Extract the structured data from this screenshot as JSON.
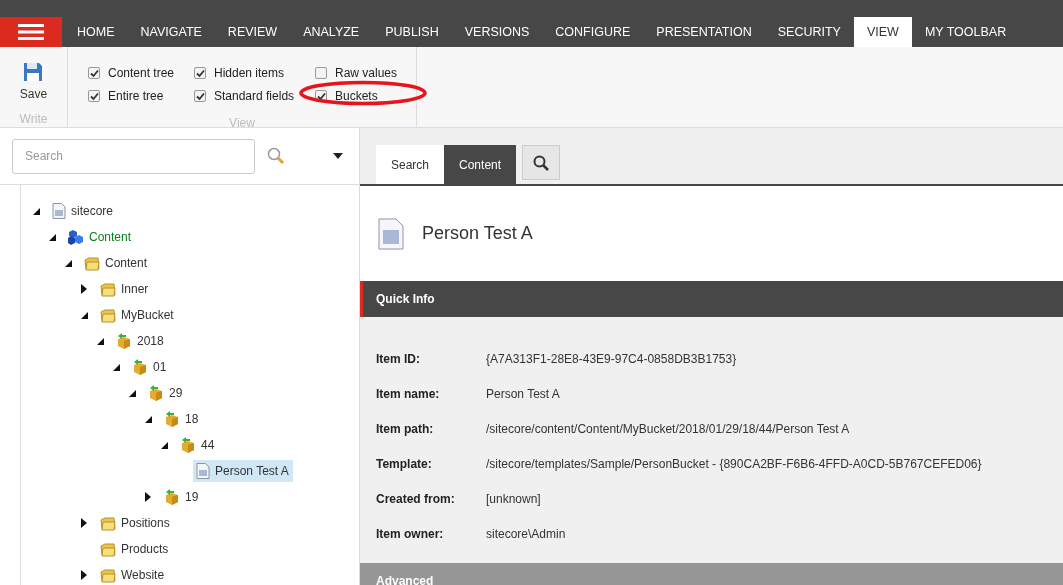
{
  "menu_tabs": [
    {
      "label": "HOME",
      "selected": false
    },
    {
      "label": "NAVIGATE",
      "selected": false
    },
    {
      "label": "REVIEW",
      "selected": false
    },
    {
      "label": "ANALYZE",
      "selected": false
    },
    {
      "label": "PUBLISH",
      "selected": false
    },
    {
      "label": "VERSIONS",
      "selected": false
    },
    {
      "label": "CONFIGURE",
      "selected": false
    },
    {
      "label": "PRESENTATION",
      "selected": false
    },
    {
      "label": "SECURITY",
      "selected": false
    },
    {
      "label": "VIEW",
      "selected": true
    },
    {
      "label": "MY TOOLBAR",
      "selected": false
    }
  ],
  "ribbon": {
    "write": {
      "button": "Save",
      "group_label": "Write"
    },
    "view": {
      "group_label": "View",
      "options": [
        {
          "label": "Content tree",
          "checked": true
        },
        {
          "label": "Entire tree",
          "checked": true
        },
        {
          "label": "Hidden items",
          "checked": true
        },
        {
          "label": "Standard fields",
          "checked": true
        },
        {
          "label": "Raw values",
          "checked": false
        },
        {
          "label": "Buckets",
          "checked": true
        }
      ]
    }
  },
  "search": {
    "placeholder": "Search"
  },
  "tree": [
    {
      "label": "sitecore",
      "kind": "page",
      "expanded": true,
      "selected": false,
      "children": [
        {
          "label": "Content",
          "kind": "root",
          "expanded": true,
          "selected": false,
          "children": [
            {
              "label": "Content",
              "kind": "folder",
              "expanded": true,
              "selected": false,
              "children": [
                {
                  "label": "Inner",
                  "kind": "folder",
                  "expanded": false,
                  "selected": false
                },
                {
                  "label": "MyBucket",
                  "kind": "folder",
                  "expanded": true,
                  "selected": false,
                  "children": [
                    {
                      "label": "2018",
                      "kind": "bucket",
                      "expanded": true,
                      "selected": false,
                      "children": [
                        {
                          "label": "01",
                          "kind": "bucket",
                          "expanded": true,
                          "selected": false,
                          "children": [
                            {
                              "label": "29",
                              "kind": "bucket",
                              "expanded": true,
                              "selected": false,
                              "children": [
                                {
                                  "label": "18",
                                  "kind": "bucket",
                                  "expanded": true,
                                  "selected": false,
                                  "children": [
                                    {
                                      "label": "44",
                                      "kind": "bucket",
                                      "expanded": true,
                                      "selected": false,
                                      "children": [
                                        {
                                          "label": "Person Test A",
                                          "kind": "page",
                                          "selected": true
                                        }
                                      ]
                                    }
                                  ]
                                },
                                {
                                  "label": "19",
                                  "kind": "bucket",
                                  "expanded": false,
                                  "selected": false
                                }
                              ]
                            }
                          ]
                        }
                      ]
                    }
                  ]
                },
                {
                  "label": "Positions",
                  "kind": "folder",
                  "expanded": false,
                  "selected": false
                },
                {
                  "label": "Products",
                  "kind": "folder",
                  "selected": false
                },
                {
                  "label": "Website",
                  "kind": "folder",
                  "expanded": false,
                  "selected": false
                }
              ]
            }
          ]
        }
      ]
    }
  ],
  "editor_tabs": [
    {
      "label": "Search",
      "selected": false
    },
    {
      "label": "Content",
      "selected": true
    }
  ],
  "item_title": "Person Test A",
  "sections": [
    {
      "title": "Quick Info",
      "expanded": true,
      "fields": [
        {
          "label": "Item ID:",
          "value": "{A7A313F1-28E8-43E9-97C4-0858DB3B1753}"
        },
        {
          "label": "Item name:",
          "value": "Person Test A"
        },
        {
          "label": "Item path:",
          "value": "/sitecore/content/Content/MyBucket/2018/01/29/18/44/Person Test A"
        },
        {
          "label": "Template:",
          "value": "/sitecore/templates/Sample/PersonBucket - {890CA2BF-F6B6-4FFD-A0CD-5B767CEFED06}"
        },
        {
          "label": "Created from:",
          "value": "[unknown]"
        },
        {
          "label": "Item owner:",
          "value": "sitecore\\Admin"
        }
      ]
    },
    {
      "title": "Advanced",
      "expanded": false
    }
  ]
}
